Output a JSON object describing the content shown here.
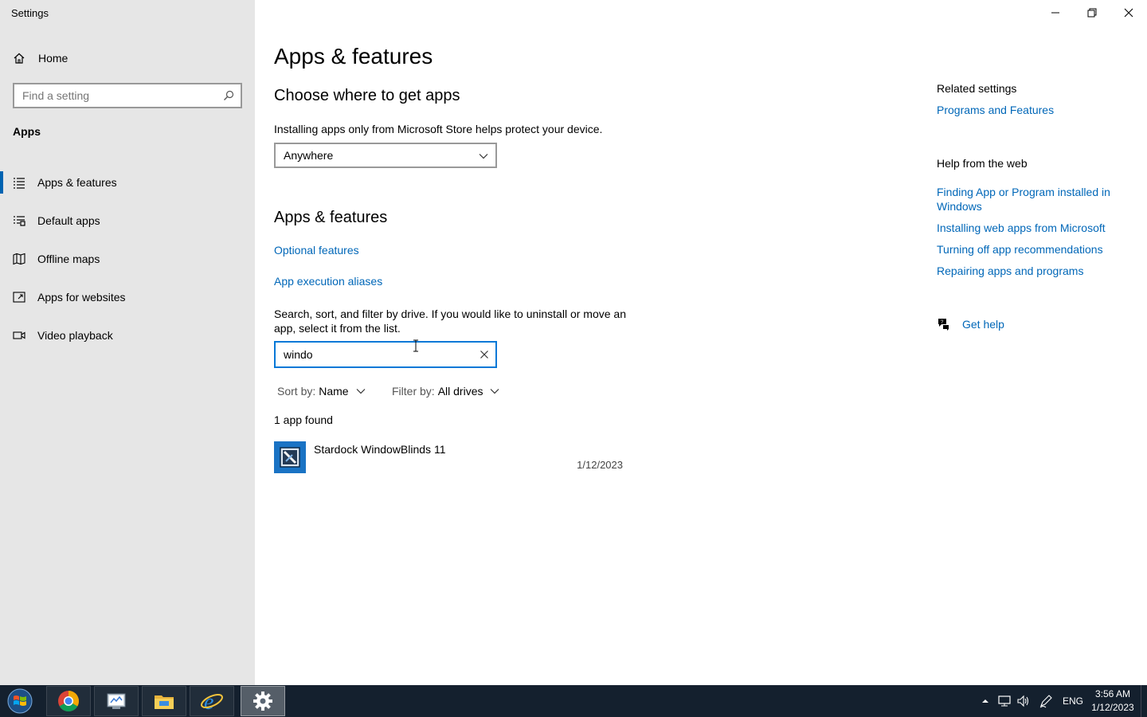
{
  "window": {
    "title": "Settings",
    "controls": [
      "minimize",
      "restore",
      "close"
    ]
  },
  "sidebar": {
    "home_label": "Home",
    "search_placeholder": "Find a setting",
    "section": "Apps",
    "items": [
      {
        "label": "Apps & features",
        "icon": "list-icon",
        "active": true
      },
      {
        "label": "Default apps",
        "icon": "default-apps-icon",
        "active": false
      },
      {
        "label": "Offline maps",
        "icon": "map-icon",
        "active": false
      },
      {
        "label": "Apps for websites",
        "icon": "website-app-icon",
        "active": false
      },
      {
        "label": "Video playback",
        "icon": "video-icon",
        "active": false
      }
    ]
  },
  "main": {
    "page_title": "Apps & features",
    "choose_heading": "Choose where to get apps",
    "choose_desc": "Installing apps only from Microsoft Store helps protect your device.",
    "source_dropdown": "Anywhere",
    "apps_heading": "Apps & features",
    "optional_features": "Optional features",
    "execution_aliases": "App execution aliases",
    "search_desc": "Search, sort, and filter by drive. If you would like to uninstall or move an app, select it from the list.",
    "search_value": "windo",
    "sort_label": "Sort by:",
    "sort_value": "Name",
    "filter_label": "Filter by:",
    "filter_value": "All drives",
    "found_text": "1 app found",
    "apps": [
      {
        "name": "Stardock WindowBlinds 11",
        "date": "1/12/2023"
      }
    ]
  },
  "related": {
    "heading": "Related settings",
    "programs_link": "Programs and Features",
    "help_heading": "Help from the web",
    "help_links": [
      "Finding App or Program installed in Windows",
      "Installing web apps from Microsoft",
      "Turning off app recommendations",
      "Repairing apps and programs"
    ],
    "get_help": "Get help"
  },
  "taskbar": {
    "apps": [
      "chrome-icon",
      "control-panel-icon",
      "file-explorer-icon",
      "internet-explorer-icon",
      "settings-icon"
    ],
    "active_app": "settings-icon",
    "language": "ENG",
    "time": "3:56 AM",
    "date": "1/12/2023"
  },
  "colors": {
    "accent": "#0078d7",
    "link": "#0067b8",
    "sidebar_bg": "#e6e6e6",
    "taskbar_bg": "#14202e"
  }
}
